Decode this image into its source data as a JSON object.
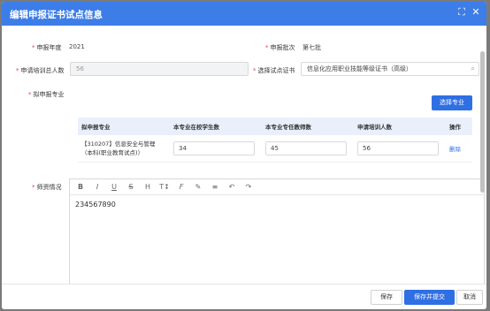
{
  "dialog": {
    "title": "编辑申报证书试点信息",
    "fullscreen_icon": "expand-icon",
    "close_icon": "close-icon"
  },
  "form": {
    "year_label": "申报年度",
    "year_value": "2021",
    "batch_label": "申报批次",
    "batch_value": "第七批",
    "trainee_label": "申请培训总人数",
    "trainee_value": "56",
    "cert_label": "选择试点证书",
    "cert_value": "信息化应用职业技能等级证书（高级）",
    "major_label": "拟申报专业",
    "select_major_button": "选择专业",
    "teacher_label": "师资情况"
  },
  "table": {
    "headers": [
      "拟申报专业",
      "本专业在校学生数",
      "本专业专任教师数",
      "申请培训人数",
      "操作"
    ],
    "rows": [
      {
        "major": "【310207】信息安全与管理（本科(职业教育试点)）",
        "students": "34",
        "teachers": "45",
        "trainees": "56",
        "action": "删除"
      }
    ]
  },
  "editor": {
    "tools": [
      "bold-icon",
      "italic-icon",
      "underline-icon",
      "strikethrough-icon",
      "heading-icon",
      "font-size-icon",
      "text-color-icon",
      "highlight-icon",
      "align-icon",
      "undo-icon",
      "redo-icon"
    ],
    "tool_glyphs": [
      "B",
      "I",
      "U",
      "S",
      "H",
      "T↕",
      "F",
      "✎",
      "≡",
      "↶",
      "↷"
    ],
    "content": "234567890"
  },
  "footer": {
    "save": "保存",
    "save_submit": "保存并提交",
    "cancel": "取消"
  },
  "colors": {
    "primary": "#2f6fe4",
    "titlebar": "#3d7de8",
    "required": "#e04646"
  }
}
